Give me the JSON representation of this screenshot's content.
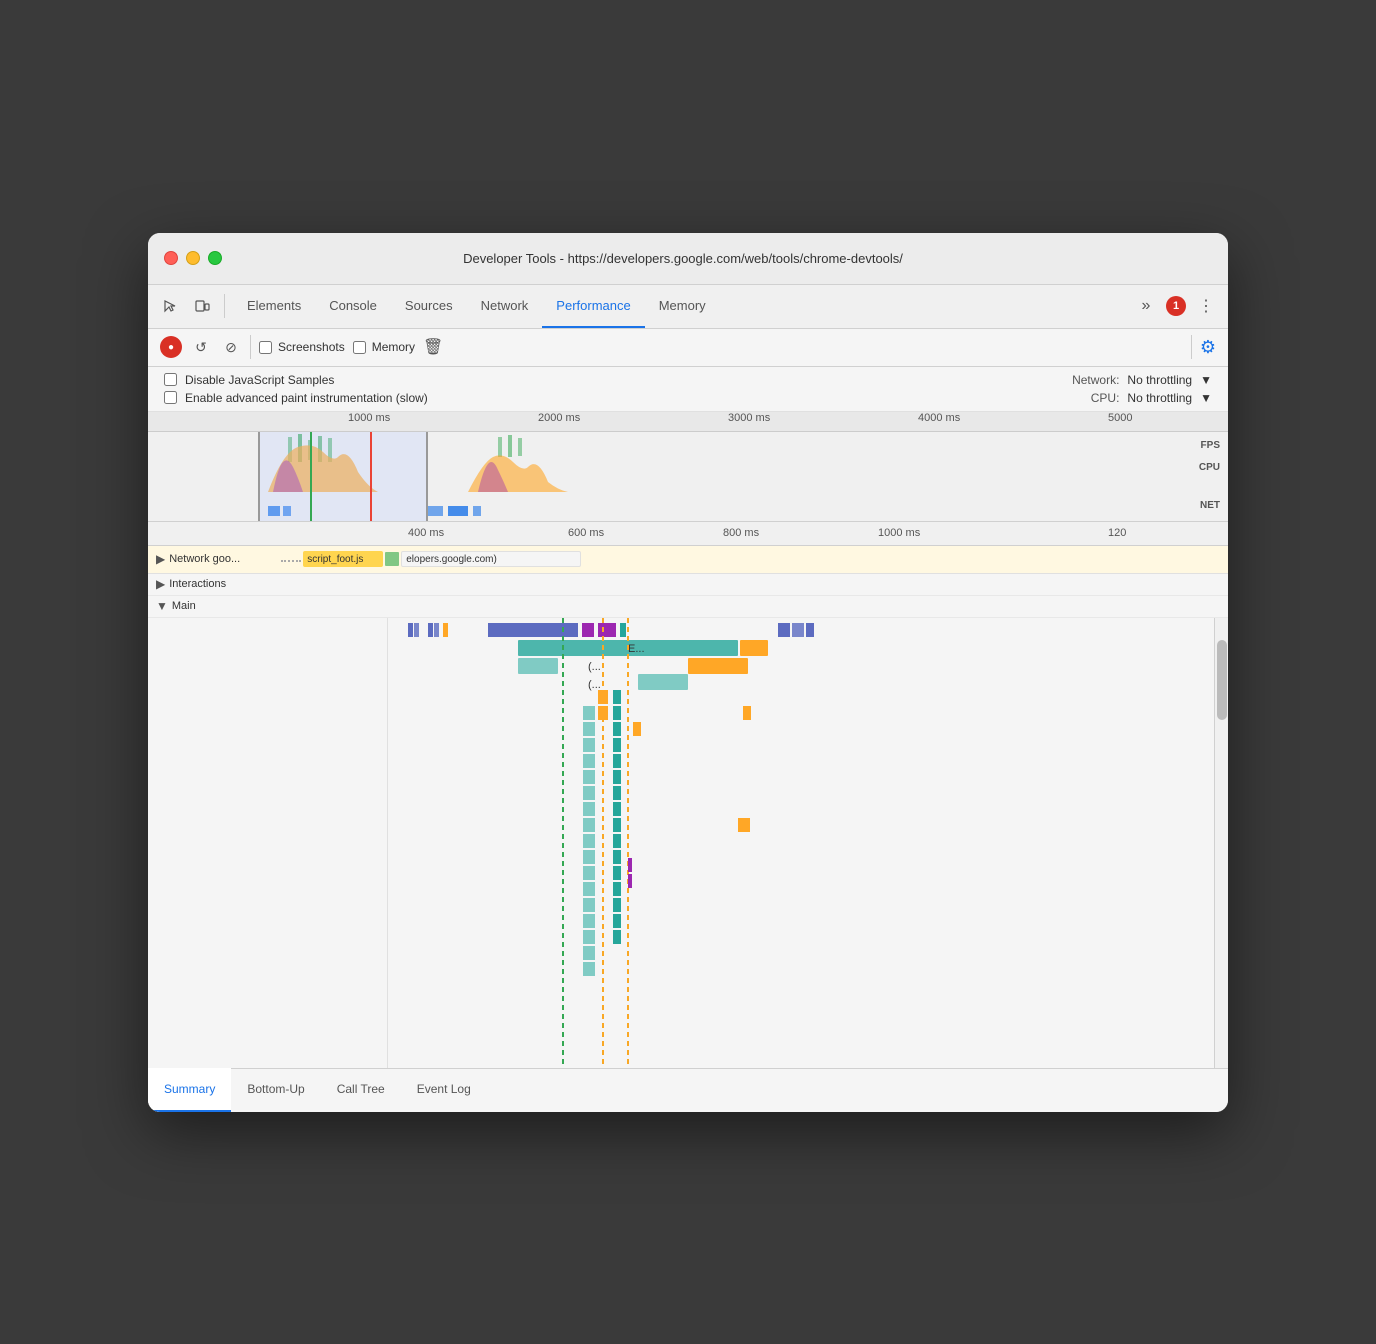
{
  "window": {
    "title": "Developer Tools - https://developers.google.com/web/tools/chrome-devtools/"
  },
  "nav": {
    "tabs": [
      {
        "id": "elements",
        "label": "Elements",
        "active": false
      },
      {
        "id": "console",
        "label": "Console",
        "active": false
      },
      {
        "id": "sources",
        "label": "Sources",
        "active": false
      },
      {
        "id": "network",
        "label": "Network",
        "active": false
      },
      {
        "id": "performance",
        "label": "Performance",
        "active": true
      },
      {
        "id": "memory",
        "label": "Memory",
        "active": false
      }
    ],
    "error_count": "1"
  },
  "toolbar": {
    "screenshots_label": "Screenshots",
    "memory_label": "Memory"
  },
  "settings": {
    "disable_js_samples": "Disable JavaScript Samples",
    "enable_paint": "Enable advanced paint instrumentation (slow)",
    "network_label": "Network:",
    "network_value": "No throttling",
    "cpu_label": "CPU:",
    "cpu_value": "No throttling"
  },
  "overview": {
    "time_marks": [
      "1000 ms",
      "2000 ms",
      "3000 ms",
      "4000 ms",
      "5000"
    ],
    "labels": [
      "FPS",
      "CPU",
      "NET"
    ]
  },
  "timeline": {
    "marks": [
      "400 ms",
      "600 ms",
      "800 ms",
      "1000 ms",
      "120"
    ],
    "network_label": "Network goo...",
    "interactions_label": "Interactions",
    "main_label": "Main"
  },
  "flame": {
    "items": [
      {
        "label": "E...",
        "color": "#4db6ac"
      },
      {
        "label": "(...",
        "color": "#ff9800"
      },
      {
        "label": "(...",
        "color": "#9c27b0"
      }
    ]
  },
  "bottom_tabs": [
    {
      "id": "summary",
      "label": "Summary",
      "active": true
    },
    {
      "id": "bottom-up",
      "label": "Bottom-Up",
      "active": false
    },
    {
      "id": "call-tree",
      "label": "Call Tree",
      "active": false
    },
    {
      "id": "event-log",
      "label": "Event Log",
      "active": false
    }
  ],
  "network_items": [
    {
      "label": "script_foot.js",
      "color": "#ffd54f"
    },
    {
      "label": "elopers.google.com)",
      "color": "#f5f5f5"
    }
  ]
}
